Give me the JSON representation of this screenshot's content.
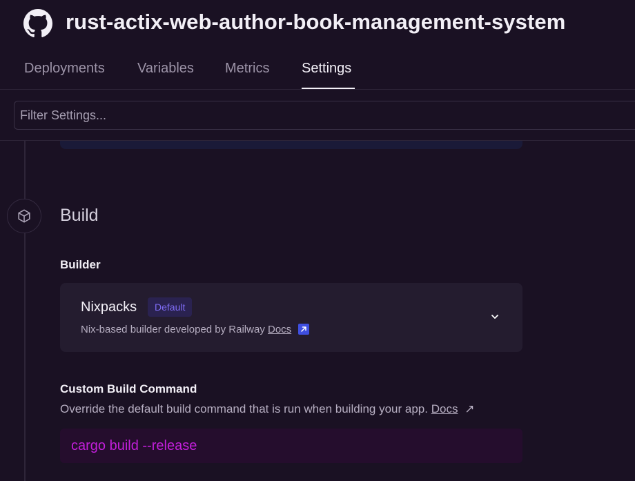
{
  "header": {
    "title": "rust-actix-web-author-book-management-system",
    "repo_icon": "github-icon"
  },
  "tabs": [
    {
      "label": "Deployments",
      "active": false
    },
    {
      "label": "Variables",
      "active": false
    },
    {
      "label": "Metrics",
      "active": false
    },
    {
      "label": "Settings",
      "active": true
    }
  ],
  "filter": {
    "placeholder": "Filter Settings...",
    "value": ""
  },
  "build": {
    "section_title": "Build",
    "section_icon": "cube-icon",
    "builder": {
      "label": "Builder",
      "name": "Nixpacks",
      "badge": "Default",
      "description": "Nix-based builder developed by Railway",
      "docs_label": "Docs",
      "external_icon": "external-link-icon",
      "dropdown_icon": "chevron-down-icon"
    },
    "custom_build_command": {
      "label": "Custom Build Command",
      "description": "Override the default build command that is run when building your app.",
      "docs_label": "Docs",
      "docs_arrow": "↗",
      "value": "cargo build --release"
    }
  },
  "colors": {
    "background": "#1a1123",
    "card": "#241c2f",
    "badge_text": "#7f6cf5",
    "command_text": "#c41fdc"
  }
}
